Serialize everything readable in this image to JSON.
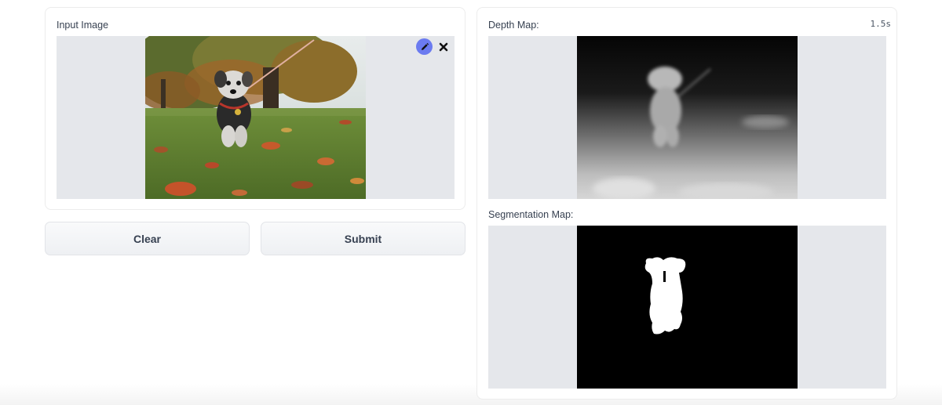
{
  "input": {
    "label": "Input Image",
    "edit_icon": "pencil-icon",
    "remove_icon": "close-icon"
  },
  "buttons": {
    "clear_label": "Clear",
    "submit_label": "Submit"
  },
  "output": {
    "timer": "1.5s",
    "depth_label": "Depth Map:",
    "segmentation_label": "Segmentation Map:"
  },
  "colors": {
    "edit_button": "#6b7bf0",
    "image_background": "#e5e7eb"
  }
}
